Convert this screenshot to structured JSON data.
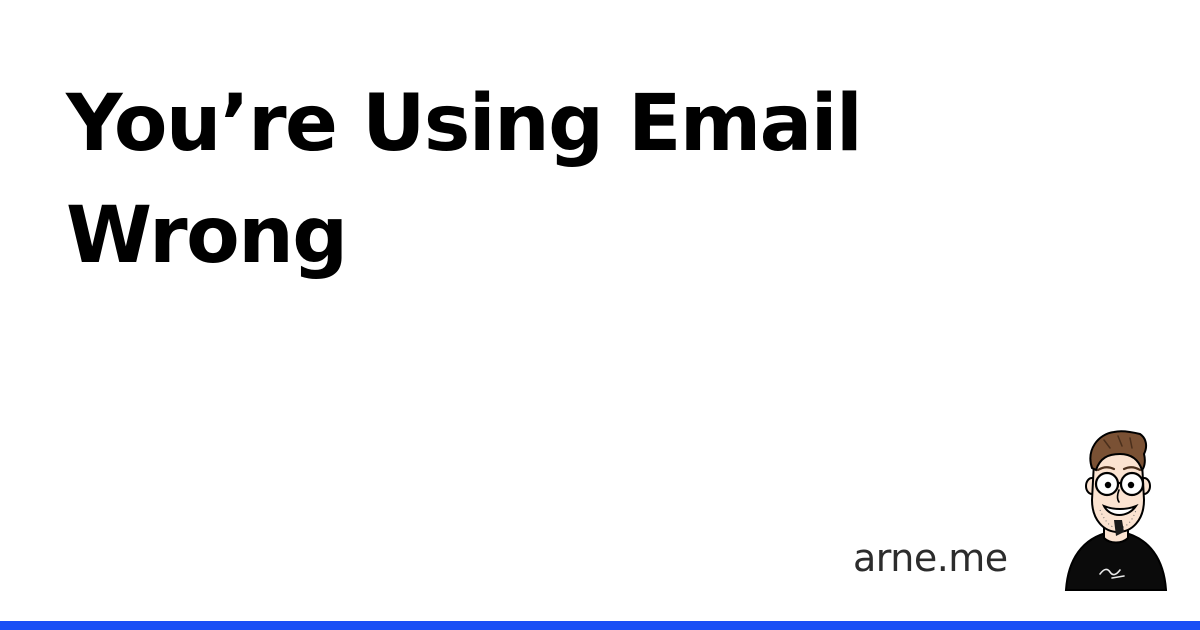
{
  "card": {
    "title": "You’re Using Email Wrong",
    "site": "arne.me"
  },
  "avatar": {
    "icon": "person-cartoon-icon"
  },
  "colors": {
    "background": "#ffffff",
    "title": "#000000",
    "site": "#2c2c2c",
    "accent_bar": "#1a4ff5",
    "shirt": "#0b0b0b",
    "skin": "#fbe3d1",
    "hair": "#7a5134"
  }
}
